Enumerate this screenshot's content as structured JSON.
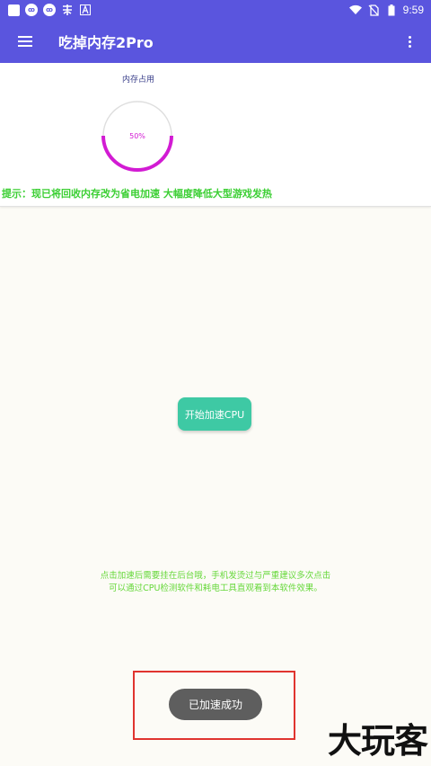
{
  "status_bar": {
    "time": "9:59",
    "left_icons": [
      "app-square-icon",
      "cloud-icon",
      "cloud-icon",
      "notification-icon",
      "a-icon"
    ],
    "right_icons": [
      "wifi-icon",
      "no-sim-icon",
      "battery-icon"
    ]
  },
  "app_bar": {
    "title": "吃掉内存2Pro",
    "background": "#5a55de"
  },
  "memory": {
    "label": "内存占用",
    "percent_text": "50%",
    "percent": 0.5,
    "arc_color": "#d21bd3"
  },
  "tip_text": "提示：现已将回收内存改为省电加速 大幅度降低大型游戏发热",
  "start_button": {
    "label": "开始加速CPU",
    "color": "#3ec9a4"
  },
  "info_lines": [
    "点击加速后需要挂在后台哦，手机发烫过与严重建议多次点击",
    "可以通过CPU检测软件和耗电工具直观看到本软件效果。"
  ],
  "toast": {
    "text": "已加速成功"
  },
  "watermark": "大玩客"
}
